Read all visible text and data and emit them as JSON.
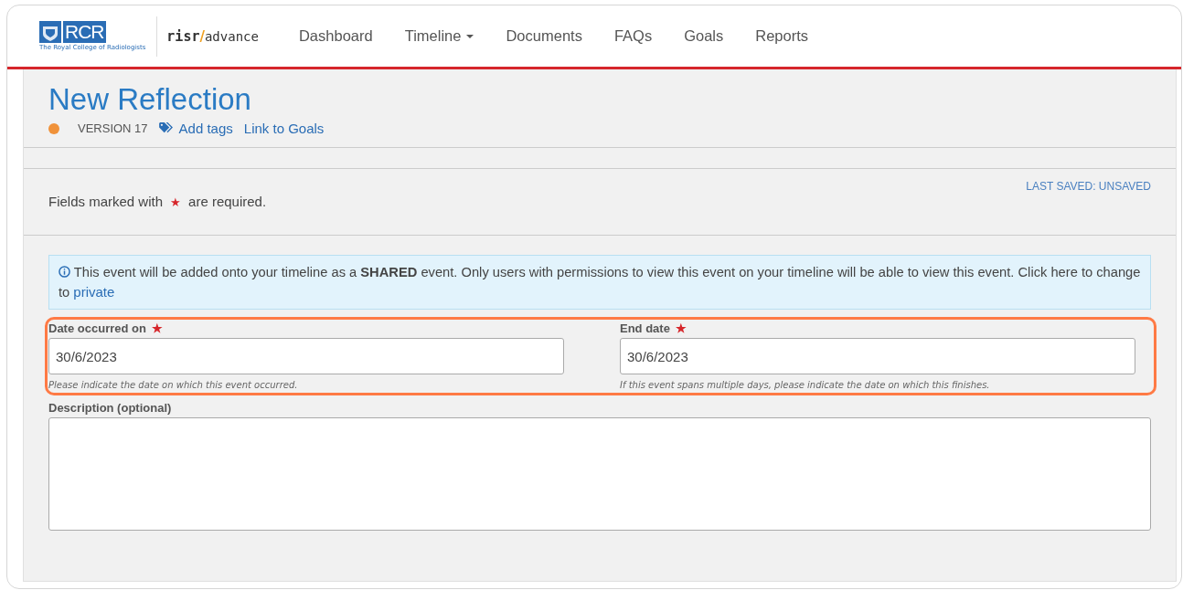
{
  "logo": {
    "mark": "RCR",
    "caption": "The Royal College of Radiologists"
  },
  "brand": {
    "prefix": "risr",
    "separator": "/",
    "suffix": "advance"
  },
  "nav": [
    {
      "label": "Dashboard",
      "dropdown": false
    },
    {
      "label": "Timeline",
      "dropdown": true
    },
    {
      "label": "Documents",
      "dropdown": false
    },
    {
      "label": "FAQs",
      "dropdown": false
    },
    {
      "label": "Goals",
      "dropdown": false
    },
    {
      "label": "Reports",
      "dropdown": false
    }
  ],
  "page": {
    "title": "New Reflection",
    "status_dot": {
      "color": "#f0923a"
    },
    "version": "VERSION 17",
    "add_tags": "Add tags",
    "link_goals": "Link to Goals"
  },
  "required_note": {
    "before": "Fields marked with",
    "mark": "★",
    "after": "are required."
  },
  "last_saved": "LAST SAVED: UNSAVED",
  "info": {
    "text": "This event will be added onto your timeline as a **SHARED** event. Only users with permissions to view this event on your timeline will be able to view this event. Click here to change to",
    "link": "private"
  },
  "date_fields": {
    "highlighted": true,
    "fields": [
      {
        "label": "Date occurred on",
        "required_mark": "★",
        "value": "30/6/2023",
        "help": "Please indicate the date on which this event occurred."
      },
      {
        "label": "End date",
        "required_mark": "★",
        "value": "30/6/2023",
        "help": "If this event spans multiple days, please indicate the date on which this finishes."
      }
    ]
  },
  "description": {
    "label": "Description (optional)"
  }
}
